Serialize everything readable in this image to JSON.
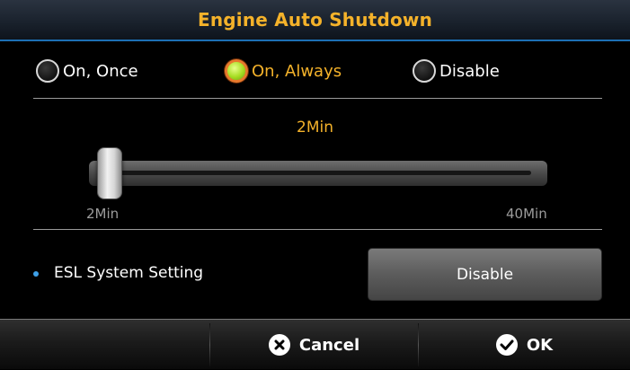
{
  "title": "Engine Auto Shutdown",
  "mode_options": [
    {
      "label": "On, Once",
      "selected": false
    },
    {
      "label": "On, Always",
      "selected": true
    },
    {
      "label": "Disable",
      "selected": false
    }
  ],
  "slider": {
    "current_value": "2Min",
    "min_label": "2Min",
    "max_label": "40Min",
    "position_fraction": 0.0
  },
  "esl": {
    "label": "ESL System Setting",
    "button_label": "Disable"
  },
  "footer": {
    "cancel_label": "Cancel",
    "ok_label": "OK",
    "cancel_icon": "close-circle-icon",
    "ok_icon": "check-circle-icon"
  },
  "colors": {
    "accent": "#f4b22a",
    "selected_radio_ring": "#e8792c",
    "selected_radio_fill": "#a6dd22",
    "bullet": "#3ea0e8"
  }
}
